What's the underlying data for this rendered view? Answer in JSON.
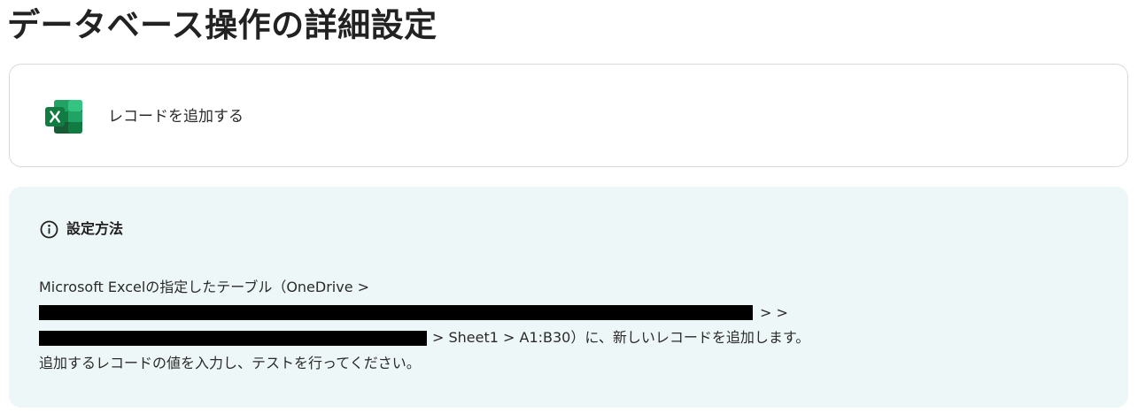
{
  "page": {
    "title": "データベース操作の詳細設定"
  },
  "action": {
    "icon": "microsoft-excel-icon",
    "label": "レコードを追加する"
  },
  "info": {
    "icon": "info-icon",
    "heading": "設定方法",
    "line1": "Microsoft Excelの指定したテーブル（OneDrive >",
    "line2_suffix": "> >",
    "line3_suffix": "> Sheet1 > A1:B30）に、新しいレコードを追加します。",
    "line4": "追加するレコードの値を入力し、テストを行ってください。"
  },
  "colors": {
    "excel_green_dark": "#185c37",
    "excel_green": "#21a366",
    "excel_green_light": "#33c481",
    "excel_badge": "#107c41",
    "panel_background": "#eef7f7",
    "card_border": "#d7d9dd",
    "redaction": "#000000"
  }
}
